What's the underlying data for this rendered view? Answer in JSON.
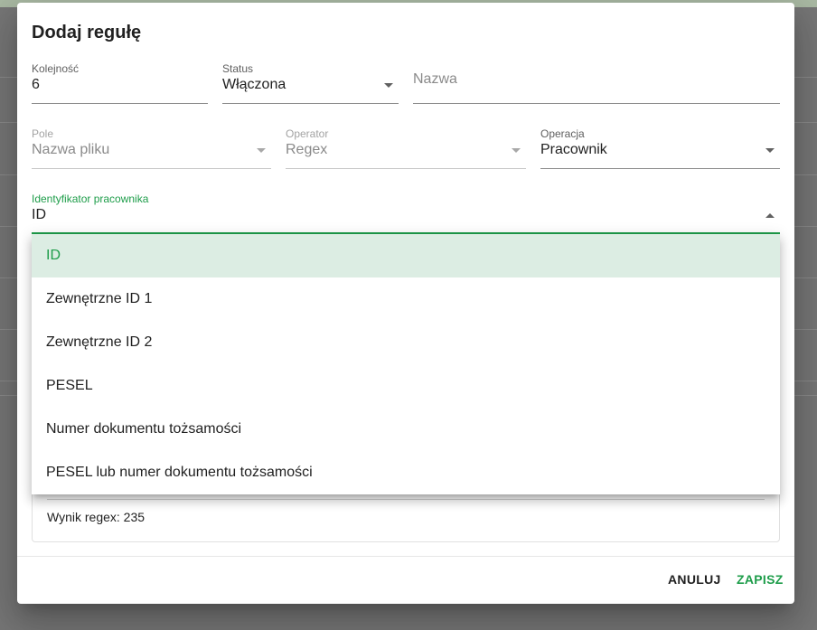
{
  "dialog": {
    "title": "Dodaj regułę",
    "fields": {
      "order": {
        "label": "Kolejność",
        "value": "6"
      },
      "status": {
        "label": "Status",
        "value": "Włączona"
      },
      "name": {
        "placeholder": "Nazwa"
      },
      "field": {
        "label": "Pole",
        "value": "Nazwa pliku"
      },
      "operator": {
        "label": "Operator",
        "value": "Regex"
      },
      "operation": {
        "label": "Operacja",
        "value": "Pracownik"
      },
      "employee_id": {
        "label": "Identyfikator pracownika",
        "value": "ID"
      }
    },
    "result": {
      "text": "Wynik regex: 235"
    },
    "buttons": {
      "cancel": "ANULUJ",
      "save": "ZAPISZ"
    }
  },
  "menu": {
    "options": [
      "ID",
      "Zewnętrzne ID 1",
      "Zewnętrzne ID 2",
      "PESEL",
      "Numer dokumentu tożsamości",
      "PESEL lub numer dokumentu tożsamości"
    ],
    "selected_index": 0
  },
  "colors": {
    "accent": "#1e9d4a",
    "selected_bg": "#dcede3"
  }
}
